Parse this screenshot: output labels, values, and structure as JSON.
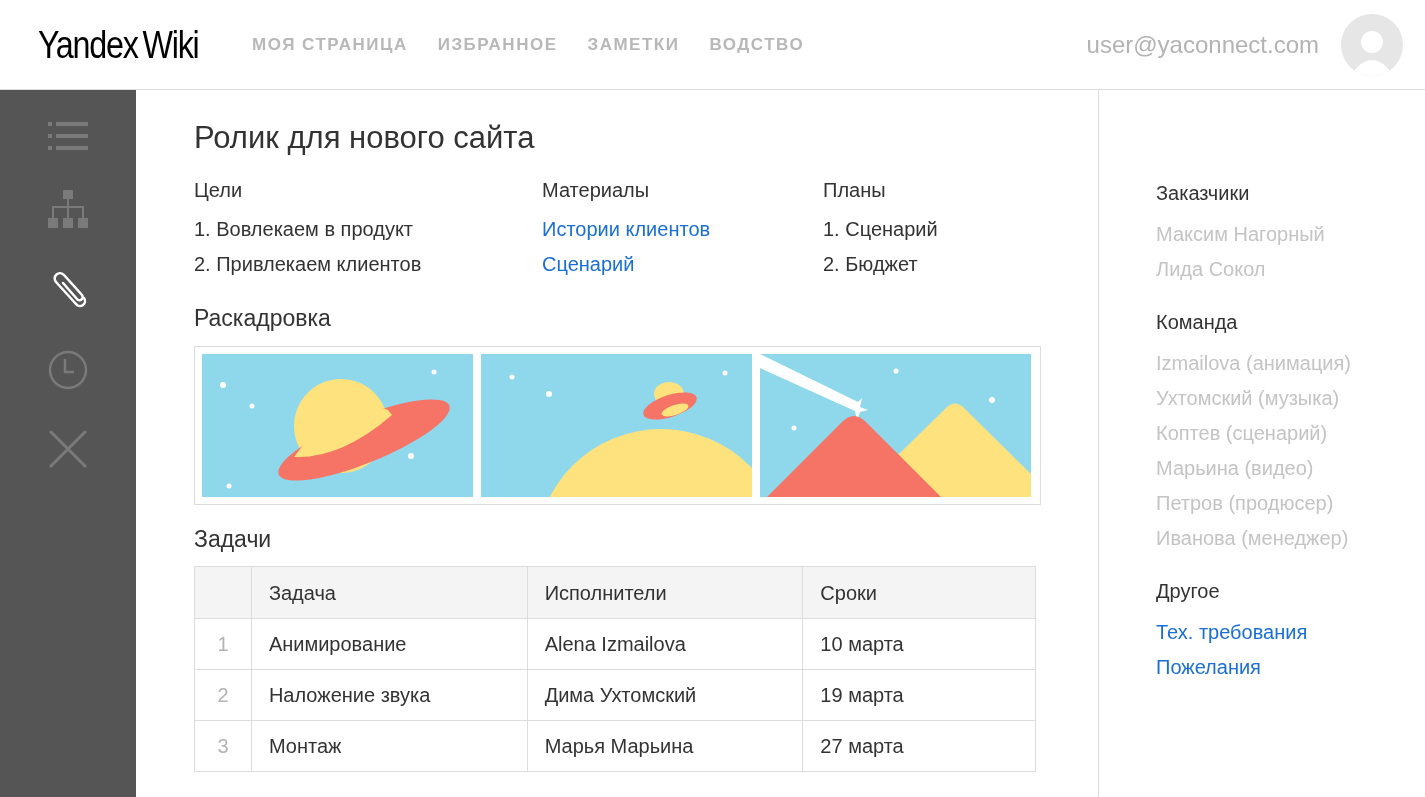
{
  "header": {
    "logo": {
      "brand": "Yandex",
      "product": "Wiki"
    },
    "nav": [
      "МОЯ СТРАНИЦА",
      "ИЗБРАННОЕ",
      "ЗАМЕТКИ",
      "ВОДСТВО"
    ],
    "user_email": "user@yaconnect.com"
  },
  "sidebar": {
    "items": [
      {
        "kind": "list",
        "selected": false
      },
      {
        "kind": "tree",
        "selected": false
      },
      {
        "kind": "clip",
        "selected": true
      },
      {
        "kind": "clock",
        "selected": false
      },
      {
        "kind": "close",
        "selected": false
      }
    ]
  },
  "page": {
    "title": "Ролик для нового сайта",
    "columns": [
      {
        "heading": "Цели",
        "items": [
          {
            "text": "1. Вовлекаем в продукт",
            "kind": "text"
          },
          {
            "text": "2. Привлекаем клиентов",
            "kind": "text"
          }
        ]
      },
      {
        "heading": "Материалы",
        "items": [
          {
            "text": "Истории клиентов",
            "kind": "link"
          },
          {
            "text": "Сценарий",
            "kind": "link"
          }
        ]
      },
      {
        "heading": "Планы",
        "items": [
          {
            "text": "1. Сценарий",
            "kind": "text"
          },
          {
            "text": "2. Бюджет",
            "kind": "text"
          }
        ]
      }
    ],
    "storyboard": {
      "heading": "Раскадровка",
      "frames": [
        {
          "kind": "planet"
        },
        {
          "kind": "ufo"
        },
        {
          "kind": "mountains"
        }
      ]
    },
    "tasks": {
      "heading": "Задачи",
      "columns": [
        "Задача",
        "Исполнители",
        "Сроки"
      ],
      "rows": [
        {
          "num": "1",
          "task": "Анимирование",
          "assignee": "Alena Izmailova",
          "due": "10 марта"
        },
        {
          "num": "2",
          "task": "Наложение звука",
          "assignee": "Дима Ухтомский",
          "due": "19 марта"
        },
        {
          "num": "3",
          "task": "Монтаж",
          "assignee": "Марья Марьина",
          "due": "27 марта"
        }
      ]
    }
  },
  "aside": {
    "sections": [
      {
        "heading": "Заказчики",
        "items": [
          {
            "text": "Максим Нагорный",
            "kind": "person"
          },
          {
            "text": "Лида Сокол",
            "kind": "person"
          }
        ]
      },
      {
        "heading": "Команда",
        "items": [
          {
            "text": "Izmailova (анимация)",
            "kind": "person"
          },
          {
            "text": "Ухтомский (музыка)",
            "kind": "person"
          },
          {
            "text": "Коптев (сценарий)",
            "kind": "person"
          },
          {
            "text": "Марьина (видео)",
            "kind": "person"
          },
          {
            "text": "Петров (продюсер)",
            "kind": "person"
          },
          {
            "text": "Иванова (менеджер)",
            "kind": "person"
          }
        ]
      },
      {
        "heading": "Другое",
        "items": [
          {
            "text": "Тех. требования",
            "kind": "link"
          },
          {
            "text": "Пожелания",
            "kind": "link"
          }
        ]
      }
    ]
  }
}
